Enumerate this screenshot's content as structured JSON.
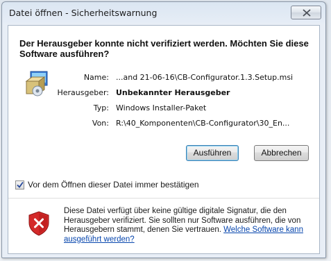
{
  "window": {
    "title": "Datei öffnen - Sicherheitswarnung"
  },
  "headline": "Der Herausgeber konnte nicht verifiziert werden. Möchten Sie diese Software ausführen?",
  "details": [
    {
      "label": "Name:",
      "value": "...and 21-06-16\\CB-Configurator.1.3.Setup.msi",
      "bold": false
    },
    {
      "label": "Herausgeber:",
      "value": "Unbekannter Herausgeber",
      "bold": true
    },
    {
      "label": "Typ:",
      "value": "Windows Installer-Paket",
      "bold": false
    },
    {
      "label": "Von:",
      "value": "R:\\40_Komponenten\\CB-Configurator\\30_En...",
      "bold": false
    }
  ],
  "buttons": {
    "run": "Ausführen",
    "cancel": "Abbrechen"
  },
  "checkbox": {
    "label": "Vor dem Öffnen dieser Datei immer bestätigen",
    "checked": true
  },
  "warning": {
    "text": "Diese Datei verfügt über keine gültige digitale Signatur, die den Herausgeber verifiziert. Sie sollten nur Software ausführen, die von Herausgebern stammt, denen Sie vertrauen. ",
    "link": "Welche Software kann ausgeführt werden?"
  },
  "icons": {
    "close": "close-icon",
    "installer": "installer-package-icon",
    "shield": "security-shield-error-icon",
    "check": "checkmark-icon"
  },
  "colors": {
    "link": "#0645ad",
    "shield_red": "#d42a2a",
    "titlebar": "#dbe6f2"
  }
}
